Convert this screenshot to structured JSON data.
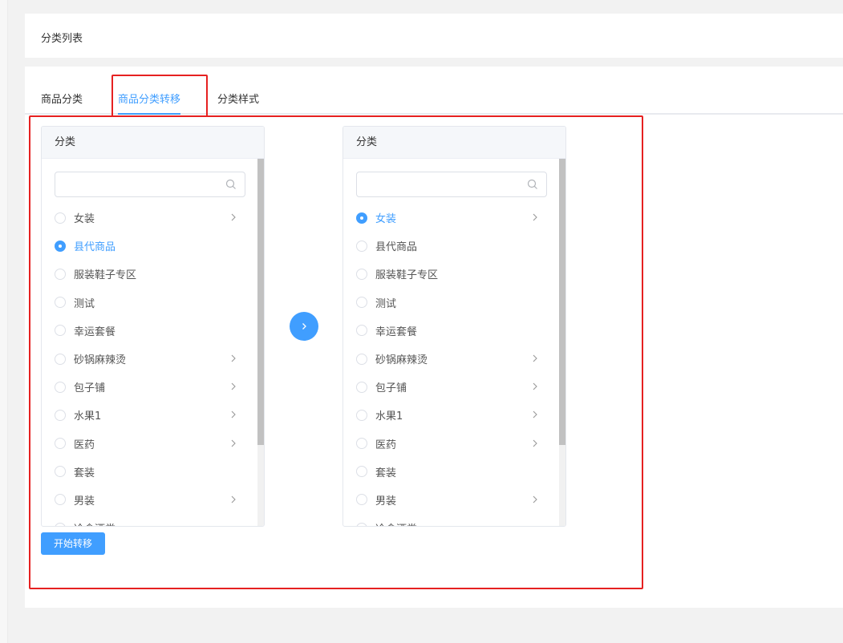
{
  "header": {
    "title": "分类列表"
  },
  "tabs": [
    {
      "label": "商品分类",
      "active": false
    },
    {
      "label": "商品分类转移",
      "active": true
    },
    {
      "label": "分类样式",
      "active": false
    }
  ],
  "left_panel": {
    "title": "分类",
    "search_placeholder": "",
    "items": [
      {
        "label": "女装",
        "selected": false,
        "has_children": true
      },
      {
        "label": "县代商品",
        "selected": true,
        "has_children": false
      },
      {
        "label": "服装鞋子专区",
        "selected": false,
        "has_children": false
      },
      {
        "label": "测试",
        "selected": false,
        "has_children": false
      },
      {
        "label": "幸运套餐",
        "selected": false,
        "has_children": false
      },
      {
        "label": "砂锅麻辣烫",
        "selected": false,
        "has_children": true
      },
      {
        "label": "包子铺",
        "selected": false,
        "has_children": true
      },
      {
        "label": "水果1",
        "selected": false,
        "has_children": true
      },
      {
        "label": "医药",
        "selected": false,
        "has_children": true
      },
      {
        "label": "套装",
        "selected": false,
        "has_children": false
      },
      {
        "label": "男装",
        "selected": false,
        "has_children": true
      },
      {
        "label": "冷食酒类",
        "selected": false,
        "has_children": false
      }
    ]
  },
  "right_panel": {
    "title": "分类",
    "search_placeholder": "",
    "items": [
      {
        "label": "女装",
        "selected": true,
        "has_children": true
      },
      {
        "label": "县代商品",
        "selected": false,
        "has_children": false
      },
      {
        "label": "服装鞋子专区",
        "selected": false,
        "has_children": false
      },
      {
        "label": "测试",
        "selected": false,
        "has_children": false
      },
      {
        "label": "幸运套餐",
        "selected": false,
        "has_children": false
      },
      {
        "label": "砂锅麻辣烫",
        "selected": false,
        "has_children": true
      },
      {
        "label": "包子铺",
        "selected": false,
        "has_children": true
      },
      {
        "label": "水果1",
        "selected": false,
        "has_children": true
      },
      {
        "label": "医药",
        "selected": false,
        "has_children": true
      },
      {
        "label": "套装",
        "selected": false,
        "has_children": false
      },
      {
        "label": "男装",
        "selected": false,
        "has_children": true
      },
      {
        "label": "冷食酒类",
        "selected": false,
        "has_children": false
      }
    ]
  },
  "actions": {
    "start_transfer": "开始转移"
  },
  "icons": {
    "search": "search-icon",
    "chevron": "chevron-right-icon",
    "transfer": "arrow-right-icon"
  },
  "colors": {
    "accent": "#409eff",
    "annotation": "#e62121"
  }
}
